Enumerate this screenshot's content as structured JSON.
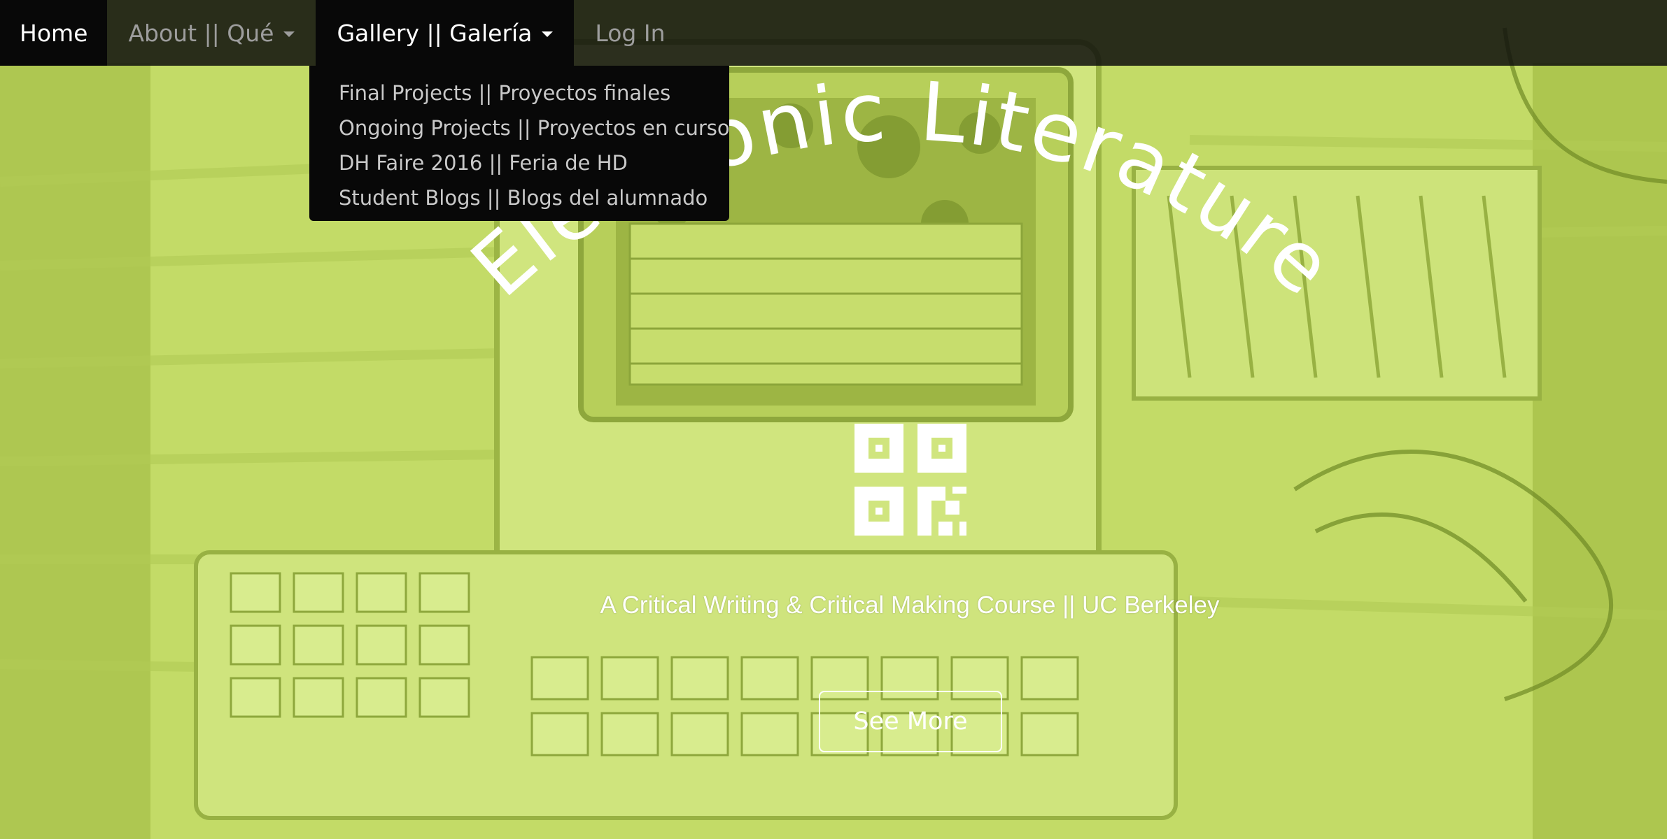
{
  "navbar": {
    "home_label": "Home",
    "about_label": "About || Qué",
    "gallery_label": "Gallery || Galería",
    "login_label": "Log In"
  },
  "gallery_dropdown": {
    "items": [
      {
        "label": "Final Projects || Proyectos finales"
      },
      {
        "label": "Ongoing Projects || Proyectos en curso"
      },
      {
        "label": "DH Faire 2016 || Feria de HD"
      },
      {
        "label": "Student Blogs || Blogs del alumnado"
      }
    ]
  },
  "hero": {
    "title": "Electronic Literature",
    "subtitle": "A Critical Writing & Critical Making Course || UC Berkeley",
    "cta_label": "See More",
    "logo_icon": "qr-code-logo-icon"
  },
  "colors": {
    "background_tint": "#c4dc6a",
    "navbar_bg": "#0c0c0c",
    "text_white": "#ffffff",
    "nav_inactive": "#9d9d9d"
  }
}
